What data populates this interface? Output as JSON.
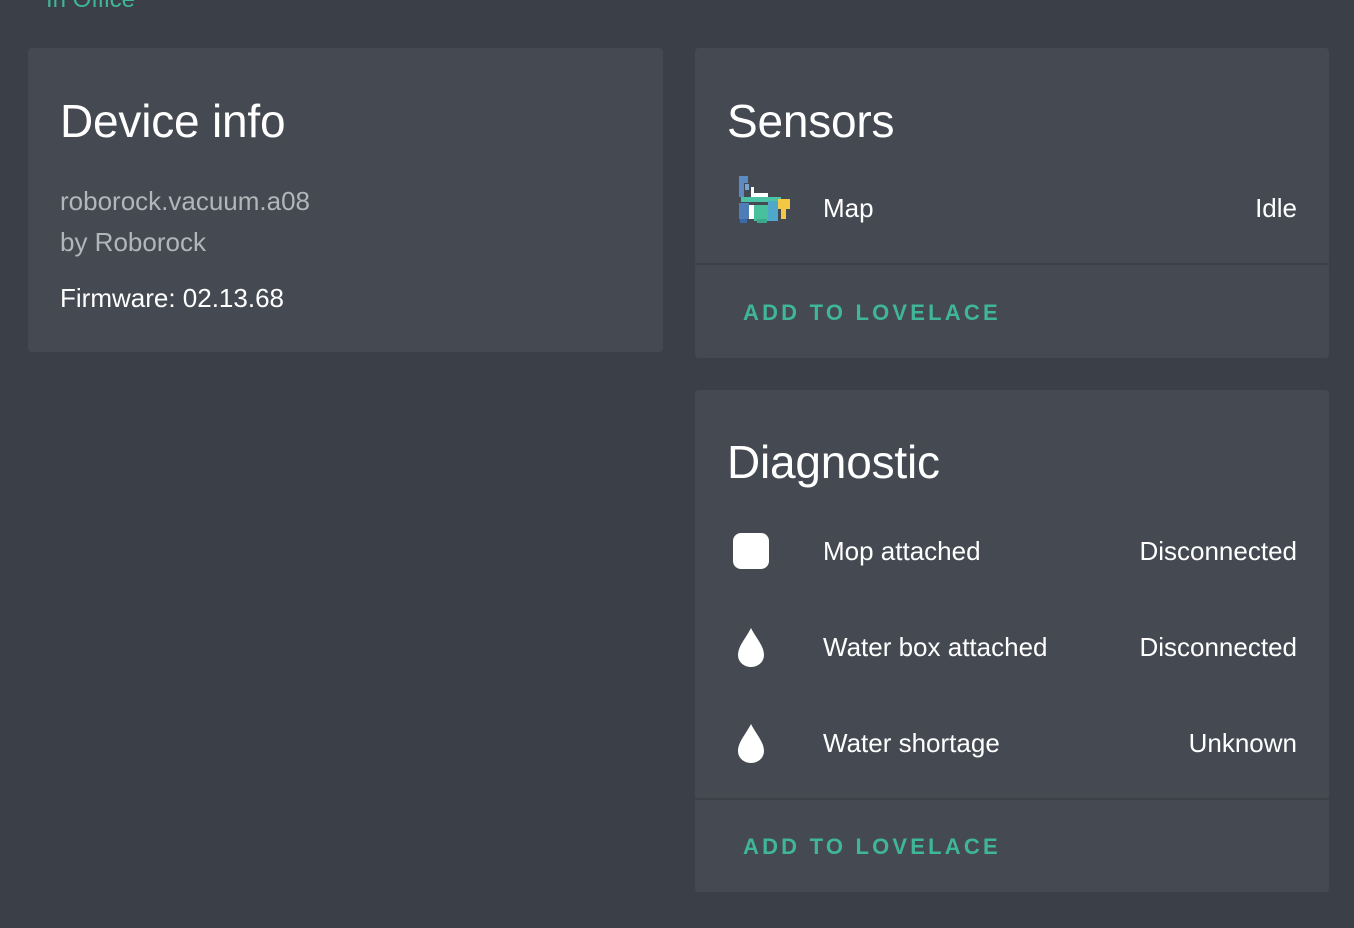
{
  "area": {
    "label": "In Office"
  },
  "device_info": {
    "title": "Device info",
    "model": "roborock.vacuum.a08",
    "manufacturer": "by Roborock",
    "firmware": "Firmware: 02.13.68"
  },
  "sensors": {
    "title": "Sensors",
    "entities": [
      {
        "name": "Map",
        "state": "Idle",
        "icon": "map-thumbnail"
      }
    ],
    "action_label": "ADD TO LOVELACE"
  },
  "diagnostic": {
    "title": "Diagnostic",
    "entities": [
      {
        "name": "Mop attached",
        "state": "Disconnected",
        "icon": "mop-icon"
      },
      {
        "name": "Water box attached",
        "state": "Disconnected",
        "icon": "water-drop-icon"
      },
      {
        "name": "Water shortage",
        "state": "Unknown",
        "icon": "water-drop-icon"
      }
    ],
    "action_label": "ADD TO LOVELACE"
  },
  "colors": {
    "background": "#3b3f47",
    "card": "#454952",
    "accent": "#3fb59a",
    "secondary_text": "#b2b5ba"
  }
}
